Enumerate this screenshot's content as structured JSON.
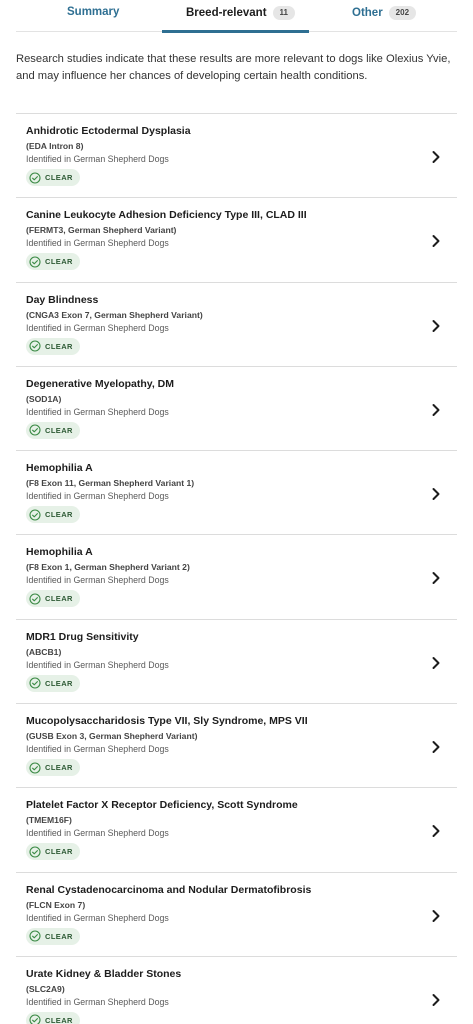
{
  "tabs": {
    "summary": "Summary",
    "breed": "Breed-relevant",
    "breed_count": "11",
    "other": "Other",
    "other_count": "202"
  },
  "intro": "Research studies indicate that these results are more relevant to dogs like Olexius Yvie, and may influence her chances of developing certain health conditions.",
  "colors": {
    "accent": "#2e6f92",
    "clear_bg": "#e6f1e7",
    "clear_fg": "#3b8a45"
  },
  "conditions": [
    {
      "title": "Anhidrotic Ectodermal Dysplasia",
      "variant": "(EDA Intron 8)",
      "identified": "Identified in German Shepherd Dogs",
      "status": "CLEAR"
    },
    {
      "title": "Canine Leukocyte Adhesion Deficiency Type III, CLAD III",
      "variant": "(FERMT3, German Shepherd Variant)",
      "identified": "Identified in German Shepherd Dogs",
      "status": "CLEAR"
    },
    {
      "title": "Day Blindness",
      "variant": "(CNGA3 Exon 7, German Shepherd Variant)",
      "identified": "Identified in German Shepherd Dogs",
      "status": "CLEAR"
    },
    {
      "title": "Degenerative Myelopathy, DM",
      "variant": "(SOD1A)",
      "identified": "Identified in German Shepherd Dogs",
      "status": "CLEAR"
    },
    {
      "title": "Hemophilia A",
      "variant": "(F8 Exon 11, German Shepherd Variant 1)",
      "identified": "Identified in German Shepherd Dogs",
      "status": "CLEAR"
    },
    {
      "title": "Hemophilia A",
      "variant": "(F8 Exon 1, German Shepherd Variant 2)",
      "identified": "Identified in German Shepherd Dogs",
      "status": "CLEAR"
    },
    {
      "title": "MDR1 Drug Sensitivity",
      "variant": "(ABCB1)",
      "identified": "Identified in German Shepherd Dogs",
      "status": "CLEAR"
    },
    {
      "title": "Mucopolysaccharidosis Type VII, Sly Syndrome, MPS VII",
      "variant": "(GUSB Exon 3, German Shepherd Variant)",
      "identified": "Identified in German Shepherd Dogs",
      "status": "CLEAR"
    },
    {
      "title": "Platelet Factor X Receptor Deficiency, Scott Syndrome",
      "variant": "(TMEM16F)",
      "identified": "Identified in German Shepherd Dogs",
      "status": "CLEAR"
    },
    {
      "title": "Renal Cystadenocarcinoma and Nodular Dermatofibrosis",
      "variant": "(FLCN Exon 7)",
      "identified": "Identified in German Shepherd Dogs",
      "status": "CLEAR"
    },
    {
      "title": "Urate Kidney & Bladder Stones",
      "variant": "(SLC2A9)",
      "identified": "Identified in German Shepherd Dogs",
      "status": "CLEAR"
    }
  ]
}
